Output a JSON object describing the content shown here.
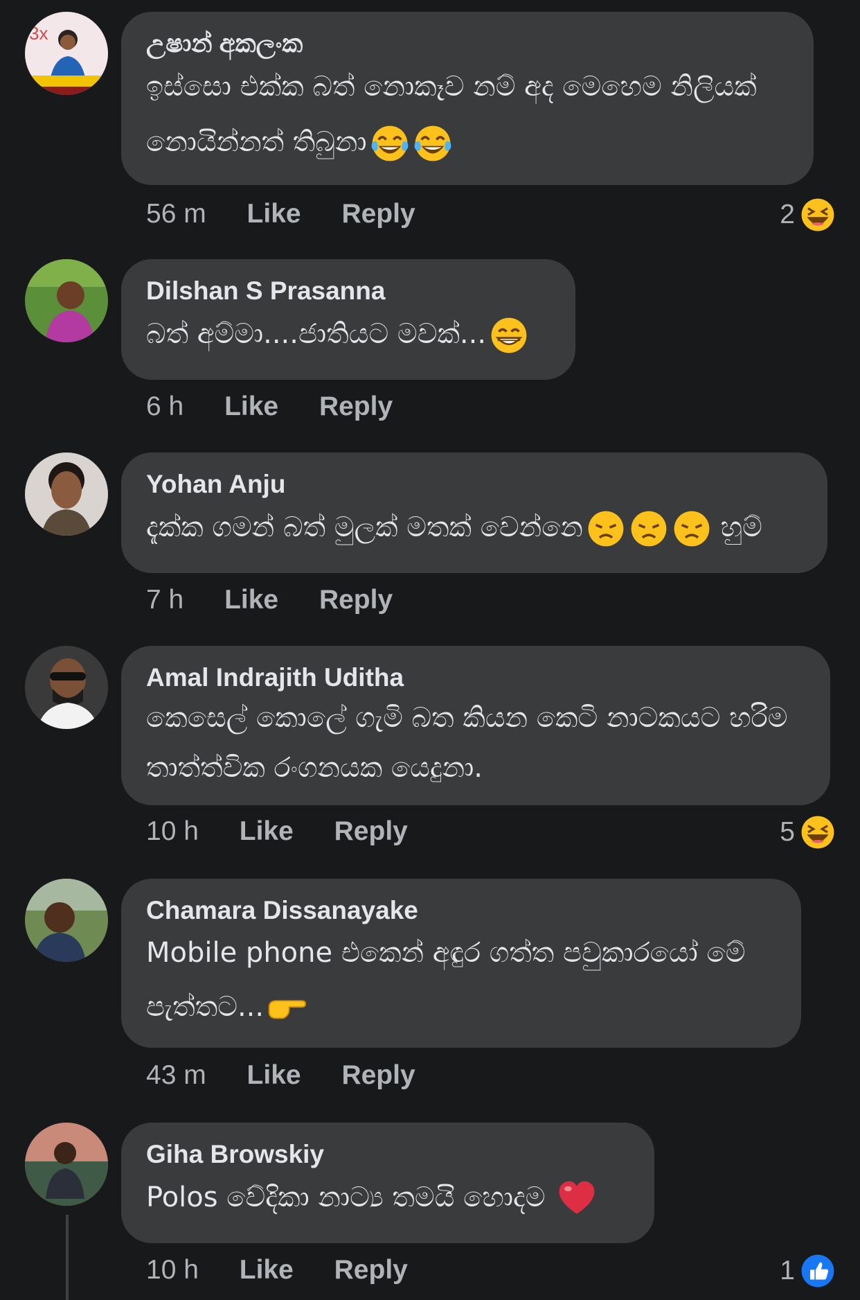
{
  "comments": [
    {
      "author": "උෂාන් අකලංක",
      "text": "ඉස්සො එක්ක බත් නොකෑව නම් අද මෙහෙම නිලියක් නොයින්නත් තිබුනා",
      "emoji": [
        "face-with-tears-of-joy",
        "face-with-tears-of-joy"
      ],
      "time": "56 m",
      "like_label": "Like",
      "reply_label": "Reply",
      "reaction_count": "2",
      "reaction_icon": "laughing-reaction-icon"
    },
    {
      "author": "Dilshan S Prasanna",
      "text": "බත් අම්මා....ජාතියට මවක්...",
      "emoji": [
        "grinning-face"
      ],
      "time": "6 h",
      "like_label": "Like",
      "reply_label": "Reply"
    },
    {
      "author": "Yohan Anju",
      "text": "දැක්ක ගමන් බත් මුලක් මතක් වෙන්නෙ",
      "emoji": [
        "disappointed-face",
        "disappointed-face",
        "disappointed-face"
      ],
      "text_after": " හුම්",
      "time": "7 h",
      "like_label": "Like",
      "reply_label": "Reply"
    },
    {
      "author": "Amal Indrajith Uditha",
      "text": "කෙසෙල් කොලේ ගැමි බත කියන කෙටි නාටකයට හරිම තාත්ත්වික රංගනයක යෙදුනා.",
      "time": "10 h",
      "like_label": "Like",
      "reply_label": "Reply",
      "reaction_count": "5",
      "reaction_icon": "laughing-reaction-icon"
    },
    {
      "author": "Chamara Dissanayake",
      "text": "Mobile phone එකෙන් අඳුර ගත්ත පවුකාරයෝ මේ පැත්තට...",
      "emoji": [
        "pointing-right-hand"
      ],
      "time": "43 m",
      "like_label": "Like",
      "reply_label": "Reply"
    },
    {
      "author": "Giha Browskiy",
      "text": "Polos වේදිකා නාට්‍ය තමයි හොදම ",
      "emoji": [
        "red-heart"
      ],
      "time": "10 h",
      "like_label": "Like",
      "reply_label": "Reply",
      "reaction_count": "1",
      "reaction_icon": "like-reaction-icon"
    }
  ],
  "colors": {
    "background": "#18191a",
    "bubble": "#3a3b3c",
    "primary_text": "#e4e6eb",
    "secondary_text": "#b0b3b8",
    "like_blue": "#1877f2",
    "emoji_yellow": "#fcc21b"
  }
}
